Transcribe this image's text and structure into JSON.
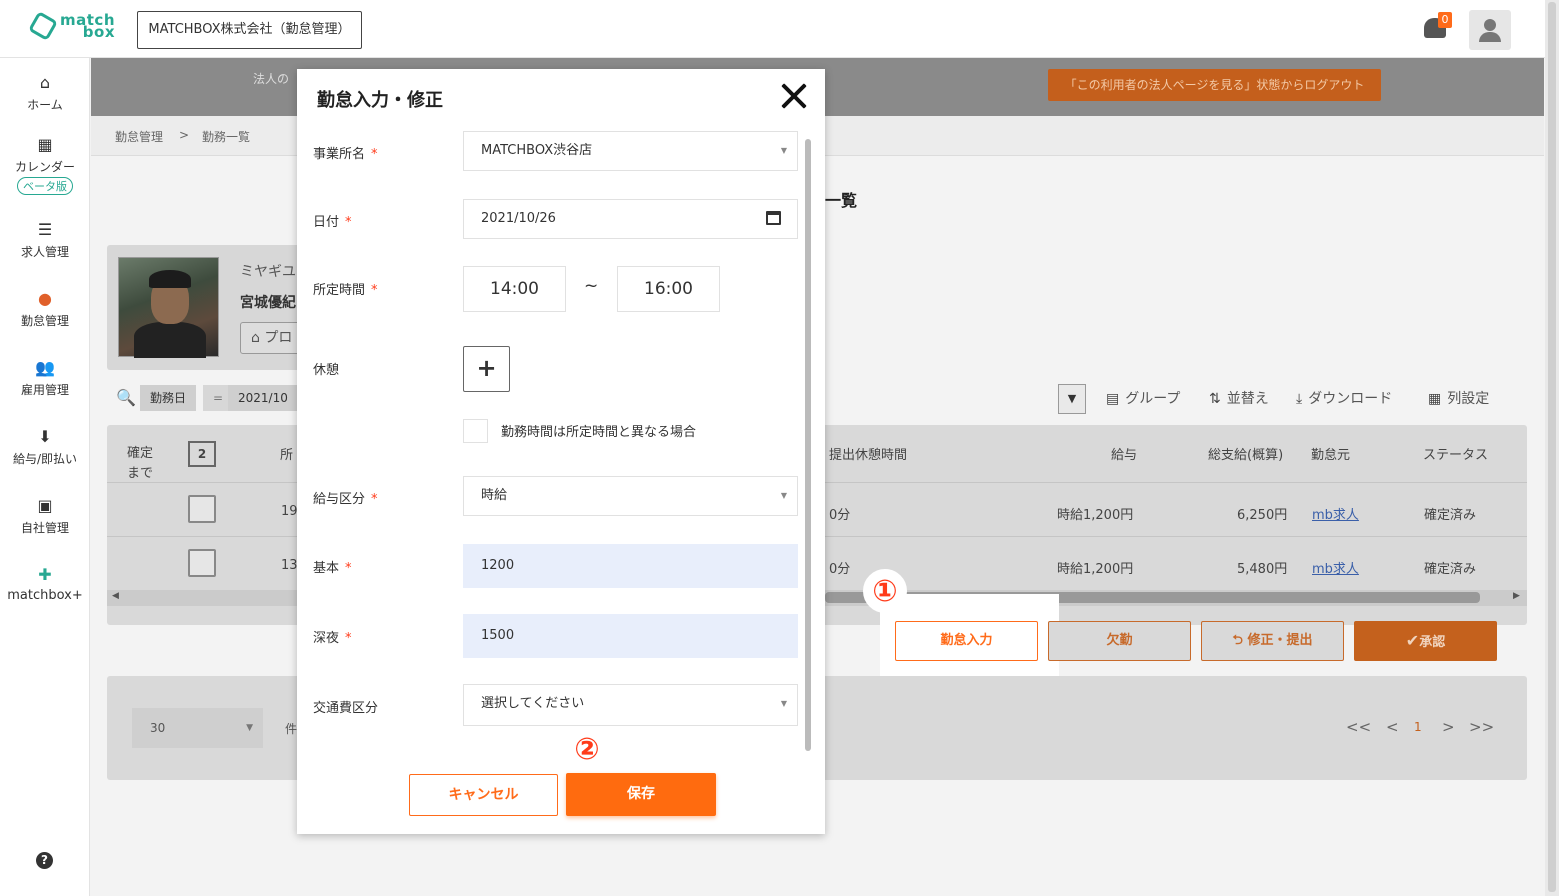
{
  "header": {
    "logo_line1": "match",
    "logo_line2": "box",
    "company": "MATCHBOX株式会社（勤怠管理）",
    "notification_count": "0"
  },
  "sidebar": {
    "items": [
      {
        "label": "ホーム",
        "icon": "home-icon"
      },
      {
        "label": "カレンダー",
        "icon": "calendar-icon",
        "badge": "ベータ版"
      },
      {
        "label": "求人管理",
        "icon": "list-icon"
      },
      {
        "label": "勤怠管理",
        "icon": "attendance-icon"
      },
      {
        "label": "雇用管理",
        "icon": "users-icon"
      },
      {
        "label": "給与/即払い",
        "icon": "download-icon"
      },
      {
        "label": "自社管理",
        "icon": "building-icon"
      },
      {
        "label": "matchbox+",
        "icon": "plus-circle-icon"
      }
    ],
    "help": "?"
  },
  "banner": {
    "text": "法人の",
    "logout_button": "「この利用者の法人ページを見る」状態からログアウト"
  },
  "breadcrumb": {
    "parent": "勤怠管理",
    "separator": ">",
    "current": "勤務一覧"
  },
  "page_title": "一覧",
  "profile": {
    "kana": "ミヤギユ",
    "name": "宮城優紀",
    "button": "プロ"
  },
  "filter": {
    "field": "勤務日",
    "op": "=",
    "value": "2021/10",
    "dropdown": "▼"
  },
  "tools": [
    "グループ",
    "並替え",
    "ダウンロード",
    "列設定"
  ],
  "table": {
    "headers": {
      "confirm": "確定\nまで",
      "count": "2",
      "col_partial": "所",
      "break": "提出休憩時間",
      "salary": "給与",
      "total": "総支給(概算)",
      "source": "勤怠元",
      "status": "ステータス"
    },
    "rows": [
      {
        "partial": "19",
        "break": "0分",
        "salary": "時給1,200円",
        "total": "6,250円",
        "source": "mb求人",
        "status": "確定済み"
      },
      {
        "partial": "13",
        "break": "0分",
        "salary": "時給1,200円",
        "total": "5,480円",
        "source": "mb求人",
        "status": "確定済み"
      }
    ]
  },
  "actions": {
    "kintai": "勤怠入力",
    "absence": "欠勤",
    "fix": "修正・提出",
    "approve": "承認"
  },
  "pagination": {
    "per_page": "30",
    "per_page_label": "件",
    "first": "<<",
    "prev": "<",
    "current": "1",
    "next": ">",
    "last": ">>"
  },
  "markers": {
    "one": "①",
    "two": "②"
  },
  "modal": {
    "title": "勤怠入力・修正",
    "fields": {
      "office": {
        "label": "事業所名",
        "value": "MATCHBOX渋谷店"
      },
      "date": {
        "label": "日付",
        "value": "2021/10/26"
      },
      "time": {
        "label": "所定時間",
        "start": "14:00",
        "tilde": "~",
        "end": "16:00"
      },
      "break": {
        "label": "休憩",
        "add": "+"
      },
      "diff": {
        "label": "勤務時間は所定時間と異なる場合"
      },
      "pay_type": {
        "label": "給与区分",
        "value": "時給"
      },
      "base": {
        "label": "基本",
        "value": "1200"
      },
      "night": {
        "label": "深夜",
        "value": "1500"
      },
      "transport": {
        "label": "交通費区分",
        "value": "選択してください"
      }
    },
    "required_mark": "*",
    "cancel": "キャンセル",
    "save": "保存"
  },
  "colors": {
    "accent": "#ff6b1a",
    "brand": "#27a892",
    "marker": "#ff3b1a"
  }
}
